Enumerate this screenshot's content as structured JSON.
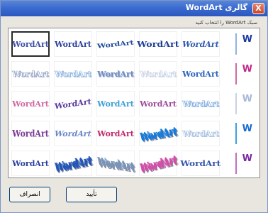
{
  "window": {
    "title": "گالری WordArt",
    "close_label": "X",
    "subtitle": "سبک WordArt را انتخاب کنید"
  },
  "gallery": {
    "sample_text": "WordArt",
    "vertical_text": "W",
    "selected_index": 0,
    "styles": [
      {
        "color": "#3c4fa8",
        "style": "plain"
      },
      {
        "color": "#2a3fa0",
        "style": "bold"
      },
      {
        "color": "#1e4a9a",
        "style": "arc"
      },
      {
        "color": "#1c3e98",
        "style": "wide"
      },
      {
        "color": "#2e5ab0",
        "style": "italic"
      },
      {
        "color": "#9aa8c8",
        "style": "outline"
      },
      {
        "color": "#8fb4e0",
        "style": "outline"
      },
      {
        "color": "#6d8cc8",
        "style": "shadow"
      },
      {
        "color": "#c8d2e6",
        "style": "outline"
      },
      {
        "color": "#2c64c0",
        "style": "bold"
      },
      {
        "color": "#d06aa0",
        "style": "pink"
      },
      {
        "color": "#5b3aa0",
        "style": "wave"
      },
      {
        "color": "#3fa0d8",
        "style": "cyan"
      },
      {
        "color": "#a04a9a",
        "style": "purple"
      },
      {
        "color": "#86b0e0",
        "style": "pale"
      },
      {
        "color": "#7a3a98",
        "style": "violet"
      },
      {
        "color": "#6a88c8",
        "style": "slant"
      },
      {
        "color": "#c02a6a",
        "style": "magenta"
      },
      {
        "color": "#1a7ad8",
        "style": "blue3d"
      },
      {
        "color": "#a8c0e0",
        "style": "pale"
      },
      {
        "color": "#2a3fa0",
        "style": "bold"
      },
      {
        "color": "#2456b8",
        "style": "3d"
      },
      {
        "color": "#7a94b8",
        "style": "perspective"
      },
      {
        "color": "#d050a8",
        "style": "pink3d"
      },
      {
        "color": "#3456a8",
        "style": "flat"
      }
    ],
    "vertical_styles": [
      {
        "color": "#1a3aa0",
        "line": "#8fb4e0"
      },
      {
        "color": "#c02a8a",
        "line": "#d06aa0"
      },
      {
        "color": "#a8b8d8",
        "line": "#c8d2e6"
      },
      {
        "color": "#1a6ad0",
        "line": "#3fa0d8"
      },
      {
        "color": "#7a2aa0",
        "line": "#c070c0"
      }
    ]
  },
  "buttons": {
    "ok": "تأیید",
    "cancel": "انصراف"
  }
}
